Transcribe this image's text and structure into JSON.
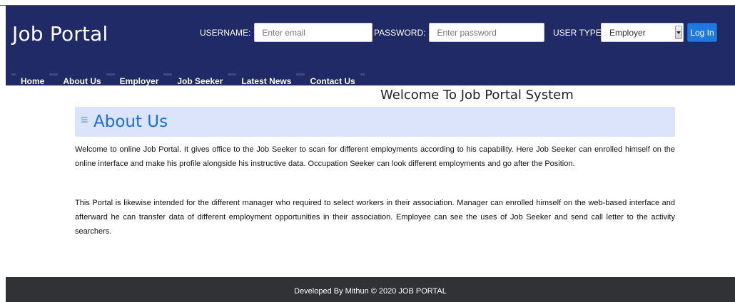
{
  "brand": "Job Portal",
  "login": {
    "username_label": "USERNAME:",
    "username_placeholder": "Enter email",
    "password_label": "PASSWORD:",
    "password_placeholder": "Enter password",
    "user_type_label": "USER TYPE:",
    "user_type_value": "Employer",
    "login_button": "Log In"
  },
  "nav": {
    "items": [
      "Home",
      "About Us",
      "Employer",
      "Job Seeker",
      "Latest News",
      "Contact Us"
    ]
  },
  "welcome": "Welcome To Job Portal System",
  "section": {
    "icon": "menu-icon",
    "title": "About Us"
  },
  "content": {
    "p1": "Welcome to online Job Portal. It gives office to the Job Seeker to scan for different employments according to his capability. Here Job Seeker can enrolled himself on the online interface and make his profile alongside his instructive data. Occupation Seeker can look different employments and go after the Position.",
    "p2": "This Portal is likewise intended for the different manager who required to select workers in their association. Manager can enrolled himself on the web-based interface and afterward he can transfer data of different employment opportunities in their association. Employee can see the uses of Job Seeker and send call letter to the activity searchers."
  },
  "footer": "Developed By Mithun © 2020 JOB PORTAL",
  "colors": {
    "header_bg": "#1f2a66",
    "accent": "#1f7ae0",
    "section_bg": "#dce4fb",
    "footer_bg": "#313236"
  }
}
